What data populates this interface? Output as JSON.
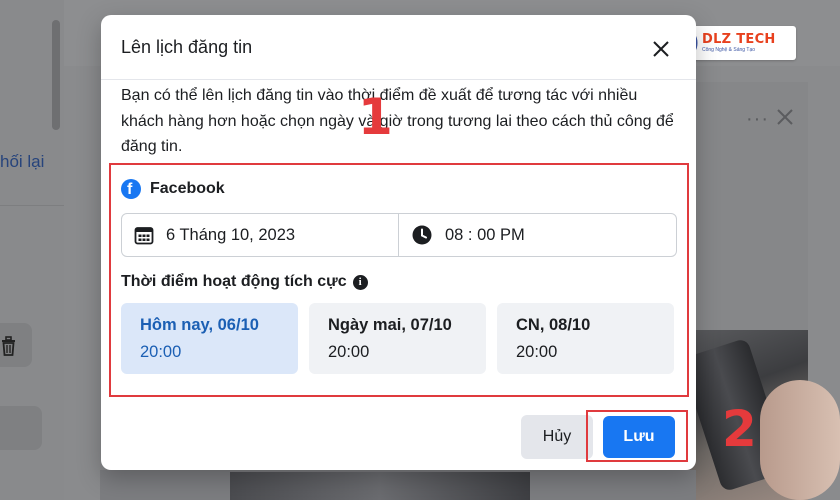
{
  "background": {
    "retry_text": "hối lại"
  },
  "logo": {
    "title": "DLZ TECH",
    "subtitle": "Công Nghệ & Sáng Tạo"
  },
  "dialog": {
    "title": "Lên lịch đăng tin",
    "description": "Bạn có thể lên lịch đăng tin vào thời điểm đề xuất để tương tác với nhiều khách hàng hơn hoặc chọn ngày và giờ trong tương lai theo cách thủ công để đăng tin.",
    "platform": {
      "icon": "facebook-icon",
      "label": "Facebook"
    },
    "date_value": "6 Tháng 10, 2023",
    "time_value": "08 : 00 PM",
    "active_times_label": "Thời điểm hoạt động tích cực",
    "slots": [
      {
        "day": "Hôm nay, 06/10",
        "time": "20:00",
        "selected": true
      },
      {
        "day": "Ngày mai, 07/10",
        "time": "20:00",
        "selected": false
      },
      {
        "day": "CN, 08/10",
        "time": "20:00",
        "selected": false
      }
    ],
    "cancel_label": "Hủy",
    "save_label": "Lưu"
  },
  "annotations": {
    "step1": "1",
    "step2": "2"
  },
  "colors": {
    "accent": "#1877f2",
    "selected_slot_bg": "#dbe7f9",
    "annotation_red": "#e03a3e"
  }
}
